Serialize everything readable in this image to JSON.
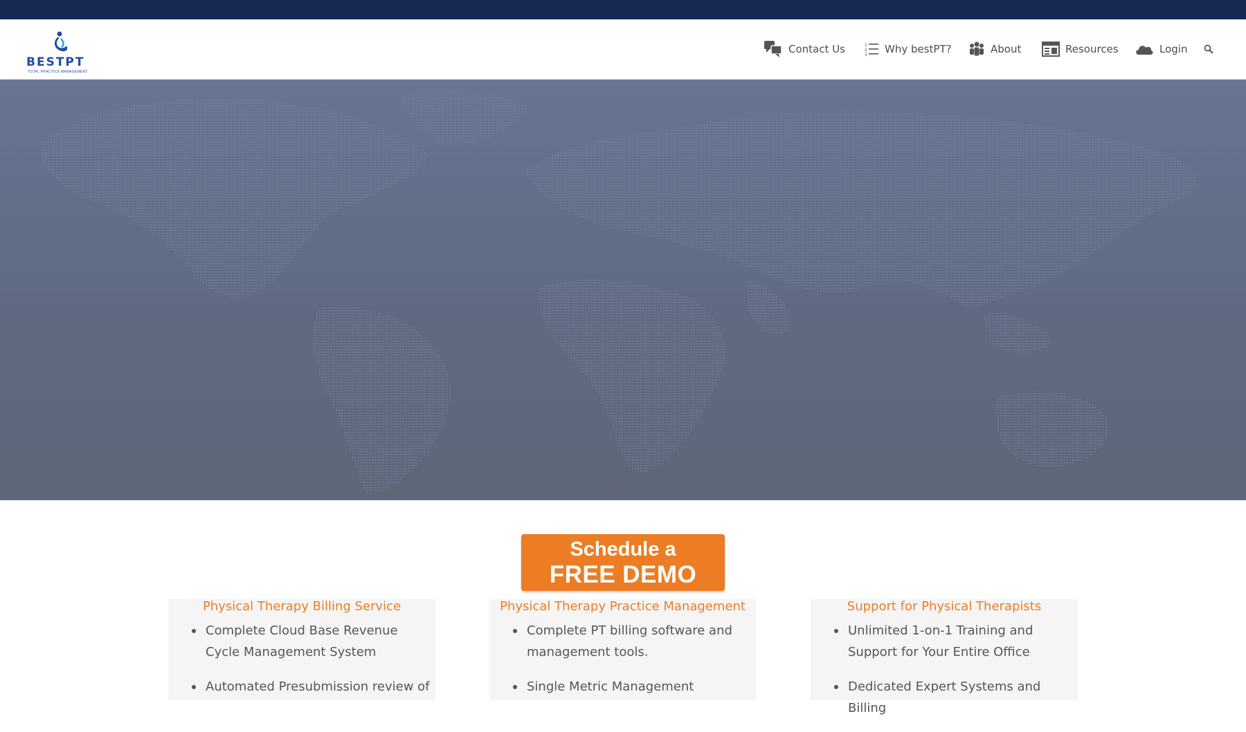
{
  "brand": {
    "name": "BESTPT",
    "tagline": "TOTAL PRACTICE MANAGEMENT",
    "accent": "#ec7d24",
    "nav_blue": "#162951"
  },
  "nav": {
    "items": [
      {
        "label": "Contact Us",
        "icon": "chat-bubbles-icon"
      },
      {
        "label": "Why bestPT?",
        "icon": "numbered-list-icon"
      },
      {
        "label": "About",
        "icon": "people-icon"
      },
      {
        "label": "Resources",
        "icon": "newspaper-icon"
      },
      {
        "label": "Login",
        "icon": "cloud-icon"
      }
    ],
    "search_icon": "search-icon"
  },
  "hero": {
    "background": "world-map"
  },
  "cta": {
    "line1": "Schedule a",
    "line2": "FREE DEMO"
  },
  "columns": [
    {
      "title": "Physical Therapy Billing Service",
      "items": [
        "Complete Cloud Base Revenue Cycle Management System",
        "Automated Presubmission review of"
      ]
    },
    {
      "title": "Physical Therapy Practice Management",
      "items": [
        "Complete PT billing software and management tools.",
        "Single Metric Management"
      ]
    },
    {
      "title": "Support for Physical Therapists",
      "items": [
        "Unlimited 1-on-1 Training and Support for Your Entire Office",
        "Dedicated Expert Systems and Billing"
      ]
    }
  ]
}
